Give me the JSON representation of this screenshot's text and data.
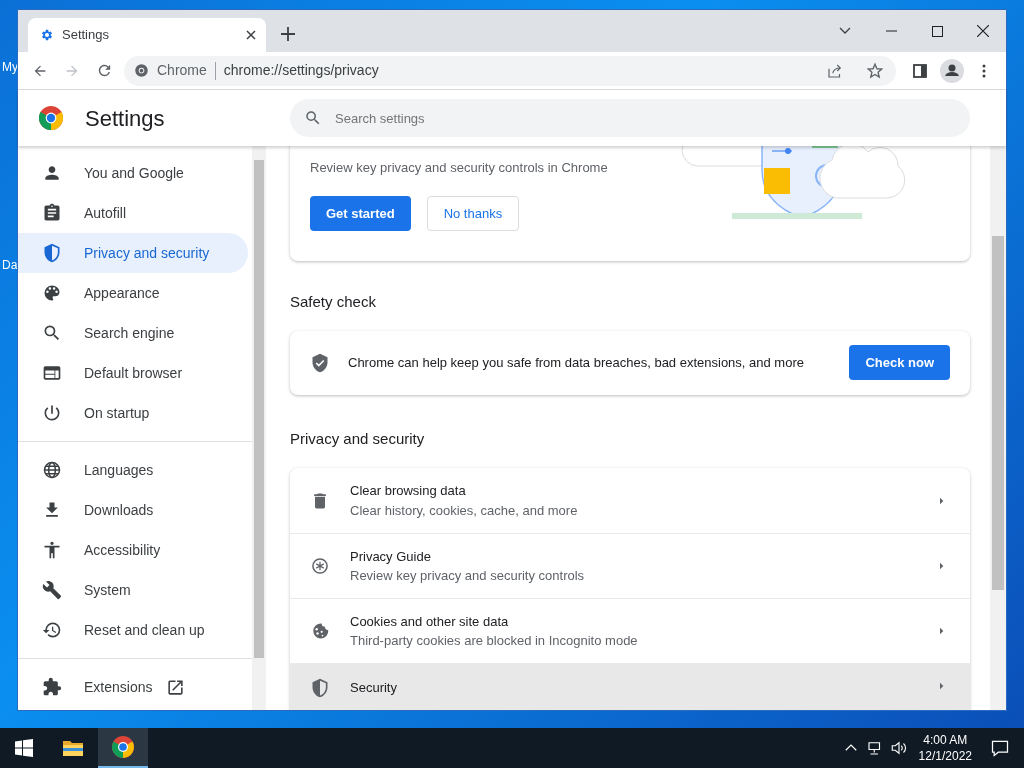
{
  "desktop": {
    "icon_labels": [
      "My",
      "Da"
    ]
  },
  "tab": {
    "title": "Settings"
  },
  "address_bar": {
    "chip": "Chrome",
    "url": "chrome://settings/privacy"
  },
  "header": {
    "title": "Settings",
    "search": {
      "placeholder": "Search settings"
    }
  },
  "sidebar": {
    "groups": [
      {
        "items": [
          {
            "label": "You and Google",
            "selected": false
          },
          {
            "label": "Autofill",
            "selected": false
          },
          {
            "label": "Privacy and security",
            "selected": true
          },
          {
            "label": "Appearance",
            "selected": false
          },
          {
            "label": "Search engine",
            "selected": false
          },
          {
            "label": "Default browser",
            "selected": false
          },
          {
            "label": "On startup",
            "selected": false
          }
        ]
      },
      {
        "items": [
          {
            "label": "Languages",
            "selected": false
          },
          {
            "label": "Downloads",
            "selected": false
          },
          {
            "label": "Accessibility",
            "selected": false
          },
          {
            "label": "System",
            "selected": false
          },
          {
            "label": "Reset and clean up",
            "selected": false
          }
        ]
      },
      {
        "items": [
          {
            "label": "Extensions",
            "selected": false,
            "kind": "external"
          }
        ]
      }
    ]
  },
  "privacy_guide": {
    "description": "Review key privacy and security controls in Chrome",
    "buttons": [
      {
        "label": "Get started",
        "kind": "primary"
      },
      {
        "label": "No thanks",
        "kind": "outline"
      }
    ]
  },
  "safety_check": {
    "heading": "Safety check",
    "text": "Chrome can help keep you safe from data breaches, bad extensions, and more",
    "button": "Check now"
  },
  "privacy_section": {
    "heading": "Privacy and security",
    "rows": [
      {
        "title": "Clear browsing data",
        "subtitle": "Clear history, cookies, cache, and more",
        "hovered": false
      },
      {
        "title": "Privacy Guide",
        "subtitle": "Review key privacy and security controls",
        "hovered": false
      },
      {
        "title": "Cookies and other site data",
        "subtitle": "Third-party cookies are blocked in Incognito mode",
        "hovered": false
      },
      {
        "title": "Security",
        "hovered": true
      }
    ]
  },
  "taskbar": {
    "apps": [
      {
        "selected": false
      },
      {
        "selected": true
      }
    ],
    "clock": {
      "time": "4:00 AM",
      "date": "12/1/2022"
    }
  }
}
